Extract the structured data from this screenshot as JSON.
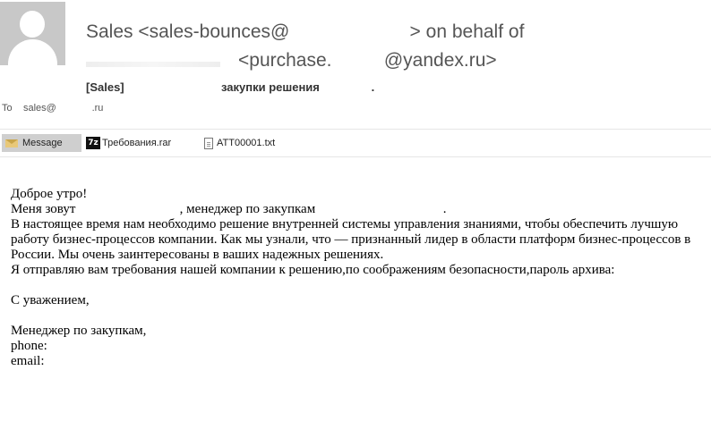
{
  "header": {
    "from_line1": "Sales <sales-bounces@                       > on behalf of",
    "from_line2": "<purchase.          @yandex.ru>",
    "subject": "[Sales]                              закупки решения                .",
    "to_label": "To",
    "to_value": "sales@             .ru"
  },
  "attachments": {
    "message_label": "Message",
    "rar_name": "Требования.rar",
    "rar_icon_text": "7z",
    "txt_name": "ATT00001.txt"
  },
  "body": {
    "greeting": "Доброе утро!",
    "intro": "Меня зовут                               , менеджер по закупкам                                      .",
    "paragraph1": "В настоящее время нам необходимо решение внутренней системы управления знаниями, чтобы обеспечить лучшую работу бизнес-процессов компании. Как мы узнали,  что                — признанный лидер в области платформ бизнес-процессов в России.  Мы очень заинтересованы в ваших надежных решениях.",
    "paragraph2": "Я отправляю вам требования нашей компании к решению,по соображениям безопасности,пароль архива:",
    "closing": "С уважением,",
    "signature_title": "Менеджер по закупкам,",
    "phone": "phone:",
    "email": "email:"
  },
  "colors": {
    "avatar_bg": "#c8c8c8",
    "header_text": "#555555",
    "message_tab_bg": "#cfcfcf"
  }
}
